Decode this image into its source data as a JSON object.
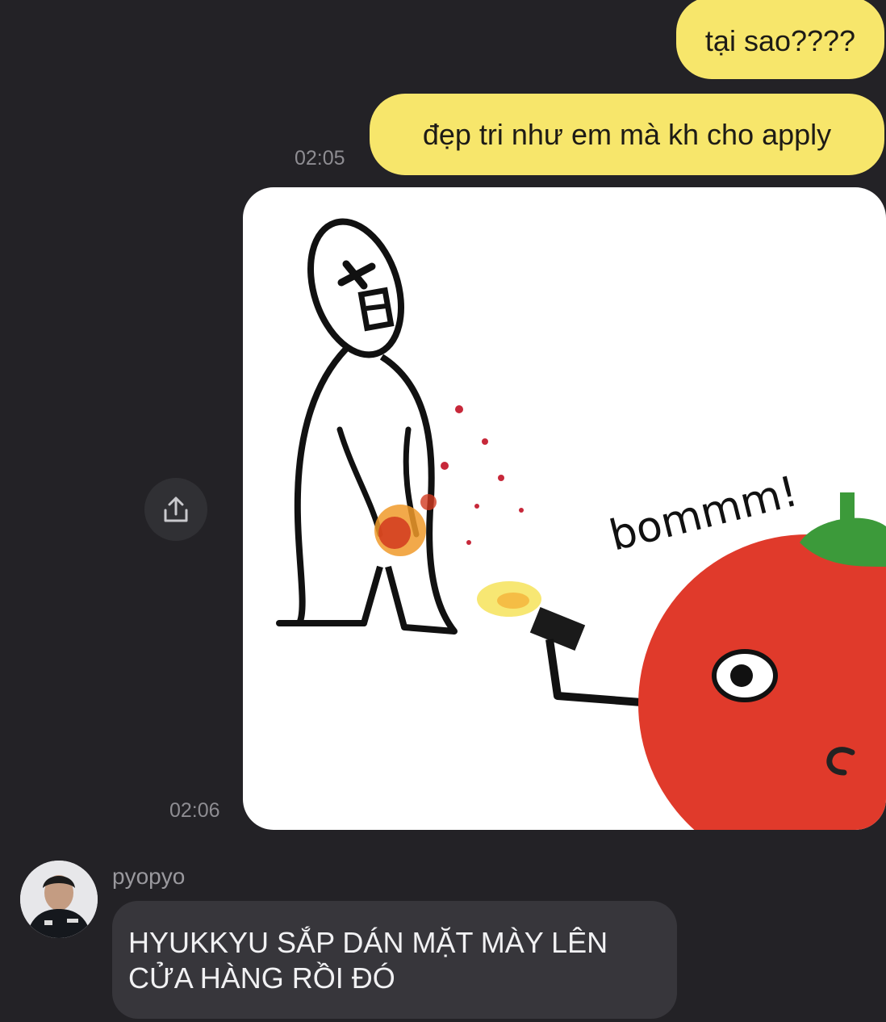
{
  "messages": {
    "outgoing_1": {
      "text": "tại sao????"
    },
    "outgoing_2": {
      "text": "đẹp tri như em mà kh cho apply",
      "time": "02:05"
    },
    "image_message": {
      "time": "02:06",
      "sticker_text": "bommm!"
    },
    "incoming_1": {
      "sender": "pyopyo",
      "line_1": "HYUKKYU SẮP DÁN MẶT MÀY LÊN",
      "line_2": "CỬA HÀNG RỒI ĐÓ"
    }
  },
  "icons": {
    "share": "share-icon",
    "avatar": "avatar"
  },
  "colors": {
    "background": "#232226",
    "outgoing_bubble": "#f7e66b",
    "incoming_bubble": "#37363b",
    "timestamp": "#8e8d92"
  }
}
